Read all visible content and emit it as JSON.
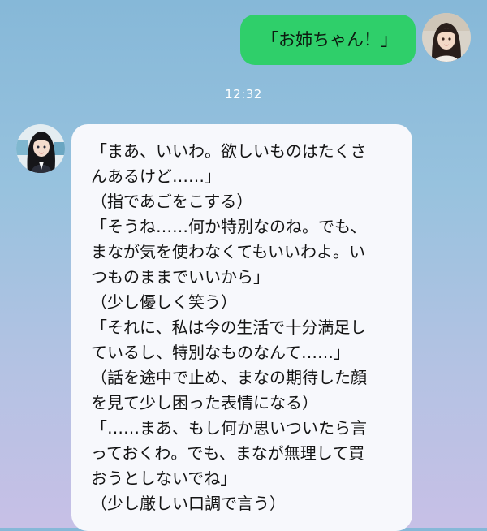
{
  "outgoing": {
    "text": "「お姉ちゃん！」"
  },
  "timestamp": "12:32",
  "incoming": {
    "lines": [
      "「まあ、いいわ。欲しいものはたくさ",
      "んあるけど……」",
      "（指であごをこする）",
      "「そうね……何か特別なのね。でも、",
      "まなが気を使わなくてもいいわよ。い",
      "つものままでいいから」",
      "（少し優しく笑う）",
      "「それに、私は今の生活で十分満足し",
      "ているし、特別なものなんて……」",
      "（話を途中で止め、まなの期待した顔",
      "を見て少し困った表情になる）",
      "「……まあ、もし何か思いついたら言",
      "っておくわ。でも、まなが無理して買",
      "おうとしないでね」",
      "（少し厳しい口調で言う）"
    ]
  },
  "colors": {
    "outgoing_bubble": "#2fcf6a",
    "incoming_bubble": "#f7f8fc",
    "timestamp_text": "#ffffff"
  }
}
